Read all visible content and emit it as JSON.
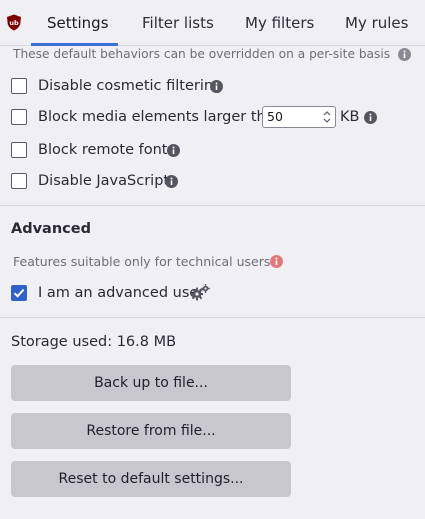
{
  "tabs": [
    {
      "label": "Settings",
      "active": true
    },
    {
      "label": "Filter lists",
      "active": false
    },
    {
      "label": "My filters",
      "active": false
    },
    {
      "label": "My rules",
      "active": false
    }
  ],
  "defaults_hint": "These default behaviors can be overridden on a per-site basis",
  "options": {
    "disable_cosmetic": {
      "label": "Disable cosmetic filtering",
      "checked": false
    },
    "block_media": {
      "label": "Block media elements larger than",
      "value": "50",
      "unit": "KB",
      "checked": false
    },
    "block_fonts": {
      "label": "Block remote fonts",
      "checked": false
    },
    "disable_js": {
      "label": "Disable JavaScript",
      "checked": false
    }
  },
  "advanced": {
    "title": "Advanced",
    "hint": "Features suitable only for technical users",
    "advanced_user": {
      "label": "I am an advanced user",
      "checked": true
    }
  },
  "storage": {
    "text": "Storage used: 16.8 MB"
  },
  "buttons": {
    "backup": "Back up to file...",
    "restore": "Restore from file...",
    "reset": "Reset to default settings..."
  },
  "colors": {
    "accent": "#3b6fd6",
    "warning_info": "#e07a7a",
    "logo": "#800000"
  },
  "icons": {
    "logo": "ublock-origin-logo",
    "info": "info-icon",
    "gears": "gears-icon",
    "check": "checkmark-icon"
  }
}
